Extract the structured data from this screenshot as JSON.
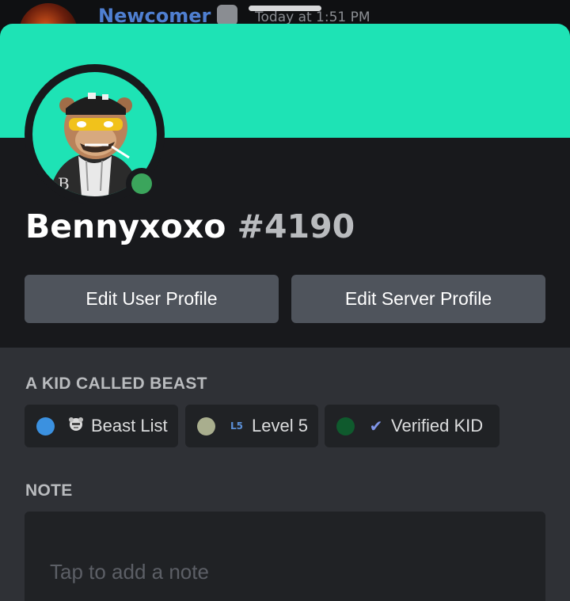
{
  "background_message": {
    "author": "Newcomer",
    "timestamp": "Today at 1:51 PM"
  },
  "profile": {
    "banner_color": "#1ee3b5",
    "status": "online",
    "status_color": "#3ba55c",
    "username": "Bennyxoxo",
    "discriminator": "#4190"
  },
  "actions": {
    "edit_user_profile": "Edit User Profile",
    "edit_server_profile": "Edit Server Profile"
  },
  "roles_section": {
    "title": "A KID CALLED BEAST",
    "roles": [
      {
        "label": "Beast List",
        "color": "#3b91e0",
        "icon": "beast-face-icon"
      },
      {
        "label": "Level 5",
        "color": "#a9ae8e",
        "icon": "L5",
        "icon_color": "#5b8fd6"
      },
      {
        "label": "Verified KID",
        "color": "#0f5a2d",
        "icon": "✔",
        "icon_color": "#7f95e8"
      }
    ]
  },
  "note_section": {
    "title": "NOTE",
    "placeholder": "Tap to add a note"
  }
}
